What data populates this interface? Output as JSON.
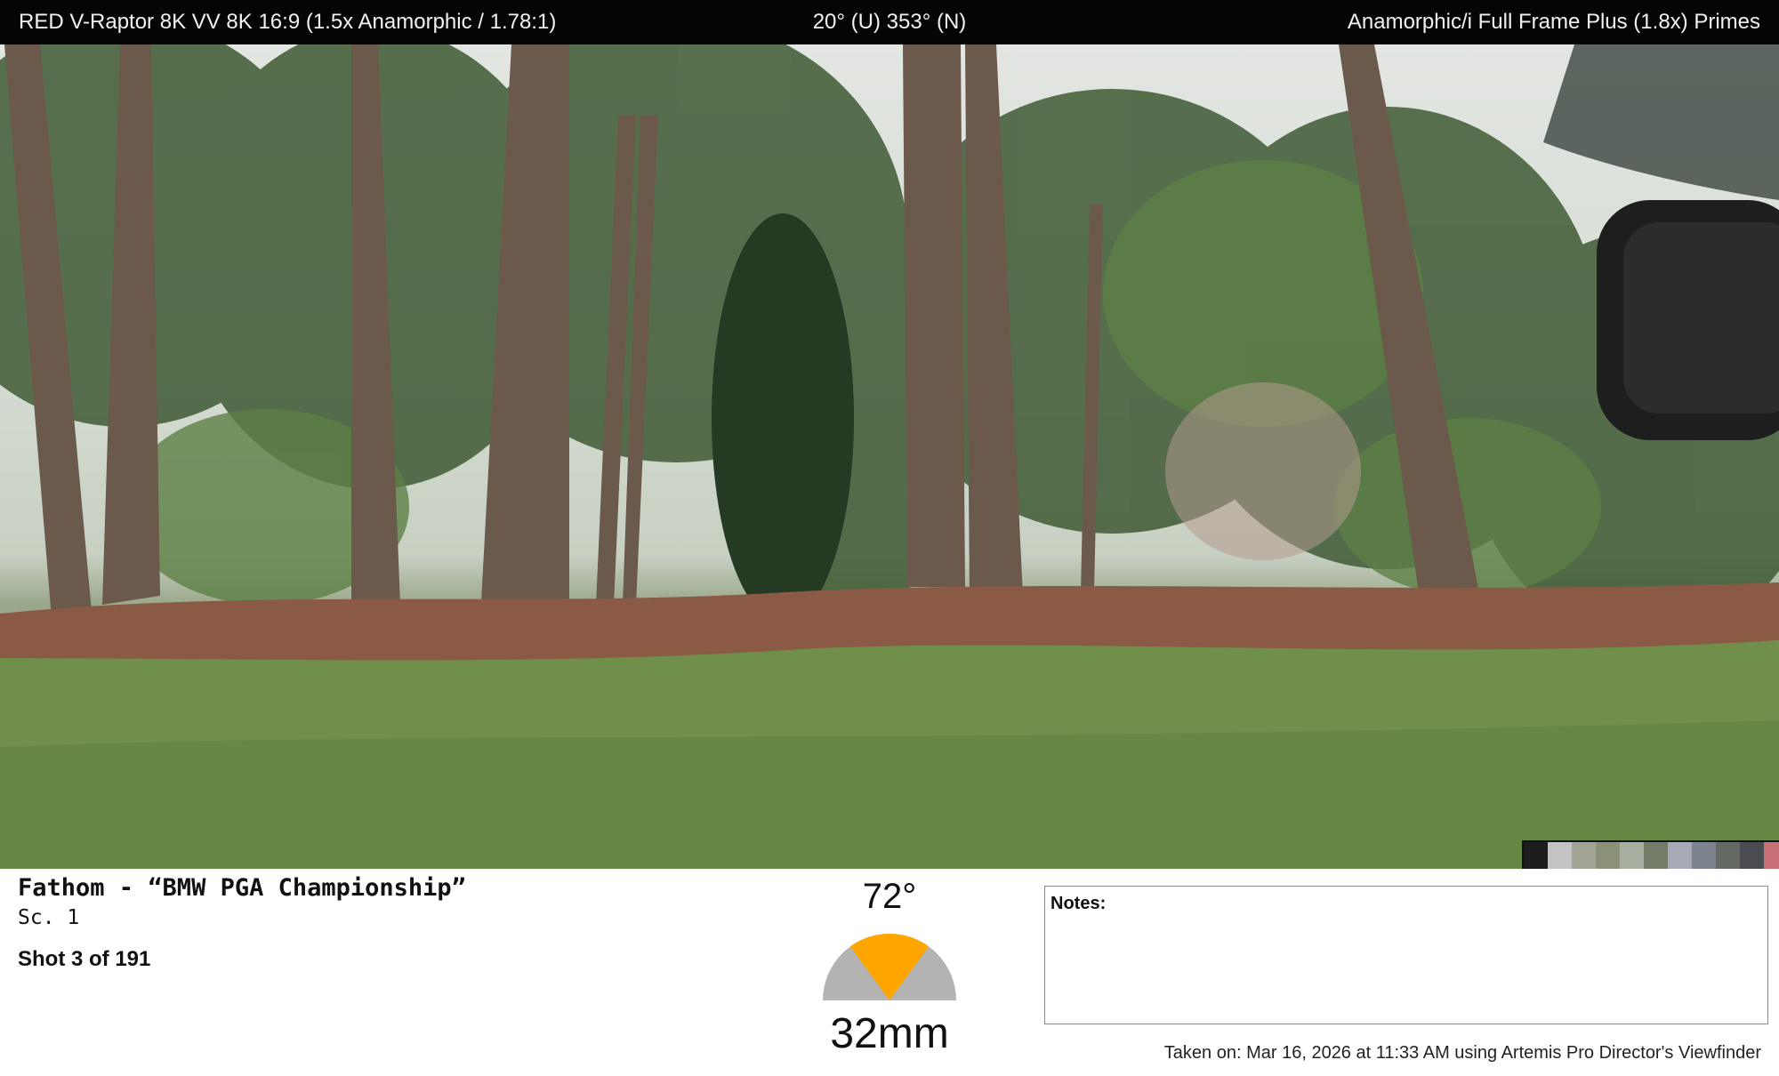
{
  "header": {
    "camera": "RED V-Raptor 8K VV 8K 16:9 (1.5x Anamorphic / 1.78:1)",
    "angle": "20° (U) 353° (N)",
    "lens": "Anamorphic/i Full Frame Plus (1.8x) Primes"
  },
  "photo": {
    "description_icon": "viewfinder-photo"
  },
  "swatches": [
    "#1c1c1c",
    "#c3c3c3",
    "#a1a394",
    "#8b9079",
    "#a8ae9f",
    "#727c69",
    "#a6a9b6",
    "#7d838f",
    "#646a62",
    "#4a4c52",
    "#c97077"
  ],
  "project": {
    "title": "Fathom - “BMW PGA Championship”",
    "scene": "Sc. 1",
    "shot": "Shot 3 of 191"
  },
  "fov": {
    "degrees": "72°",
    "focal_length": "32mm",
    "fraction_of_half_circle": 0.4,
    "gauge_colors": {
      "base": "#b3b3b3",
      "highlight": "#ffa500"
    }
  },
  "notes": {
    "label": "Notes:",
    "value": ""
  },
  "footer": {
    "taken": "Taken on: Mar 16, 2026 at 11:33 AM using Artemis Pro Director's Viewfinder"
  }
}
